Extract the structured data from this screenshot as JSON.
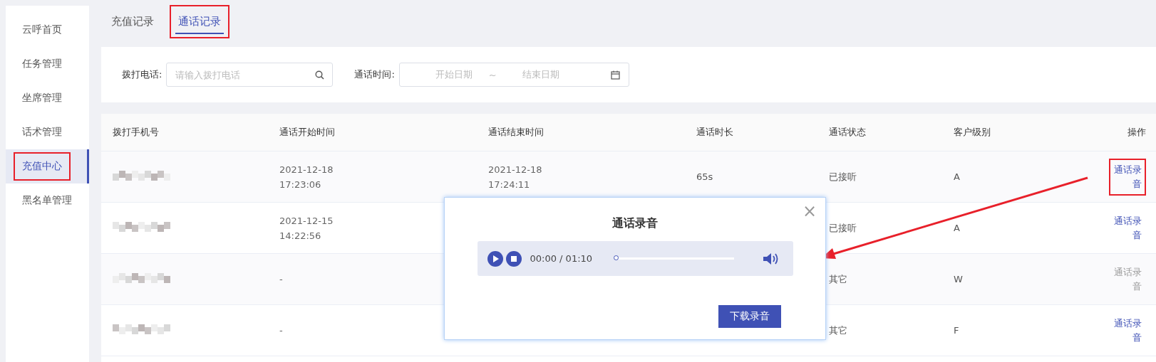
{
  "sidebar": {
    "items": [
      {
        "label": "云呼首页",
        "selected": false,
        "highlighted": false
      },
      {
        "label": "任务管理",
        "selected": false,
        "highlighted": false
      },
      {
        "label": "坐席管理",
        "selected": false,
        "highlighted": false
      },
      {
        "label": "话术管理",
        "selected": false,
        "highlighted": false
      },
      {
        "label": "充值中心",
        "selected": true,
        "highlighted": true
      },
      {
        "label": "黑名单管理",
        "selected": false,
        "highlighted": false
      }
    ]
  },
  "tabs": [
    {
      "label": "充值记录",
      "selected": false,
      "highlighted": false
    },
    {
      "label": "通话记录",
      "selected": true,
      "highlighted": true
    }
  ],
  "filters": {
    "phone": {
      "label": "拨打电话:",
      "placeholder": "请输入拨打电话"
    },
    "time": {
      "label": "通话时间:",
      "start_placeholder": "开始日期",
      "separator": "~",
      "end_placeholder": "结束日期"
    }
  },
  "table": {
    "columns": [
      "拨打手机号",
      "通话开始时间",
      "通话结束时间",
      "通话时长",
      "通话状态",
      "客户级别",
      "操作"
    ],
    "rows": [
      {
        "start": [
          "2021-12-18",
          "17:23:06"
        ],
        "end": [
          "2021-12-18",
          "17:24:11"
        ],
        "duration": "65s",
        "status": "已接听",
        "level": "A",
        "action": {
          "label": "通话录音",
          "disabled": false,
          "highlighted": true
        }
      },
      {
        "start": [
          "2021-12-15",
          "14:22:56"
        ],
        "status": "已接听",
        "level": "A",
        "action": {
          "label": "通话录音",
          "disabled": false,
          "highlighted": false
        }
      },
      {
        "start": [
          "-"
        ],
        "status": "其它",
        "level": "W",
        "action": {
          "label": "通话录音",
          "disabled": true,
          "highlighted": false
        }
      },
      {
        "start": [
          "-"
        ],
        "status": "其它",
        "level": "F",
        "action": {
          "label": "通话录音",
          "disabled": false,
          "highlighted": false
        }
      }
    ]
  },
  "dialog": {
    "title": "通话录音",
    "close": "×",
    "player": {
      "time": "00:00 / 01:10",
      "level": 0
    },
    "button": "下载录音"
  }
}
